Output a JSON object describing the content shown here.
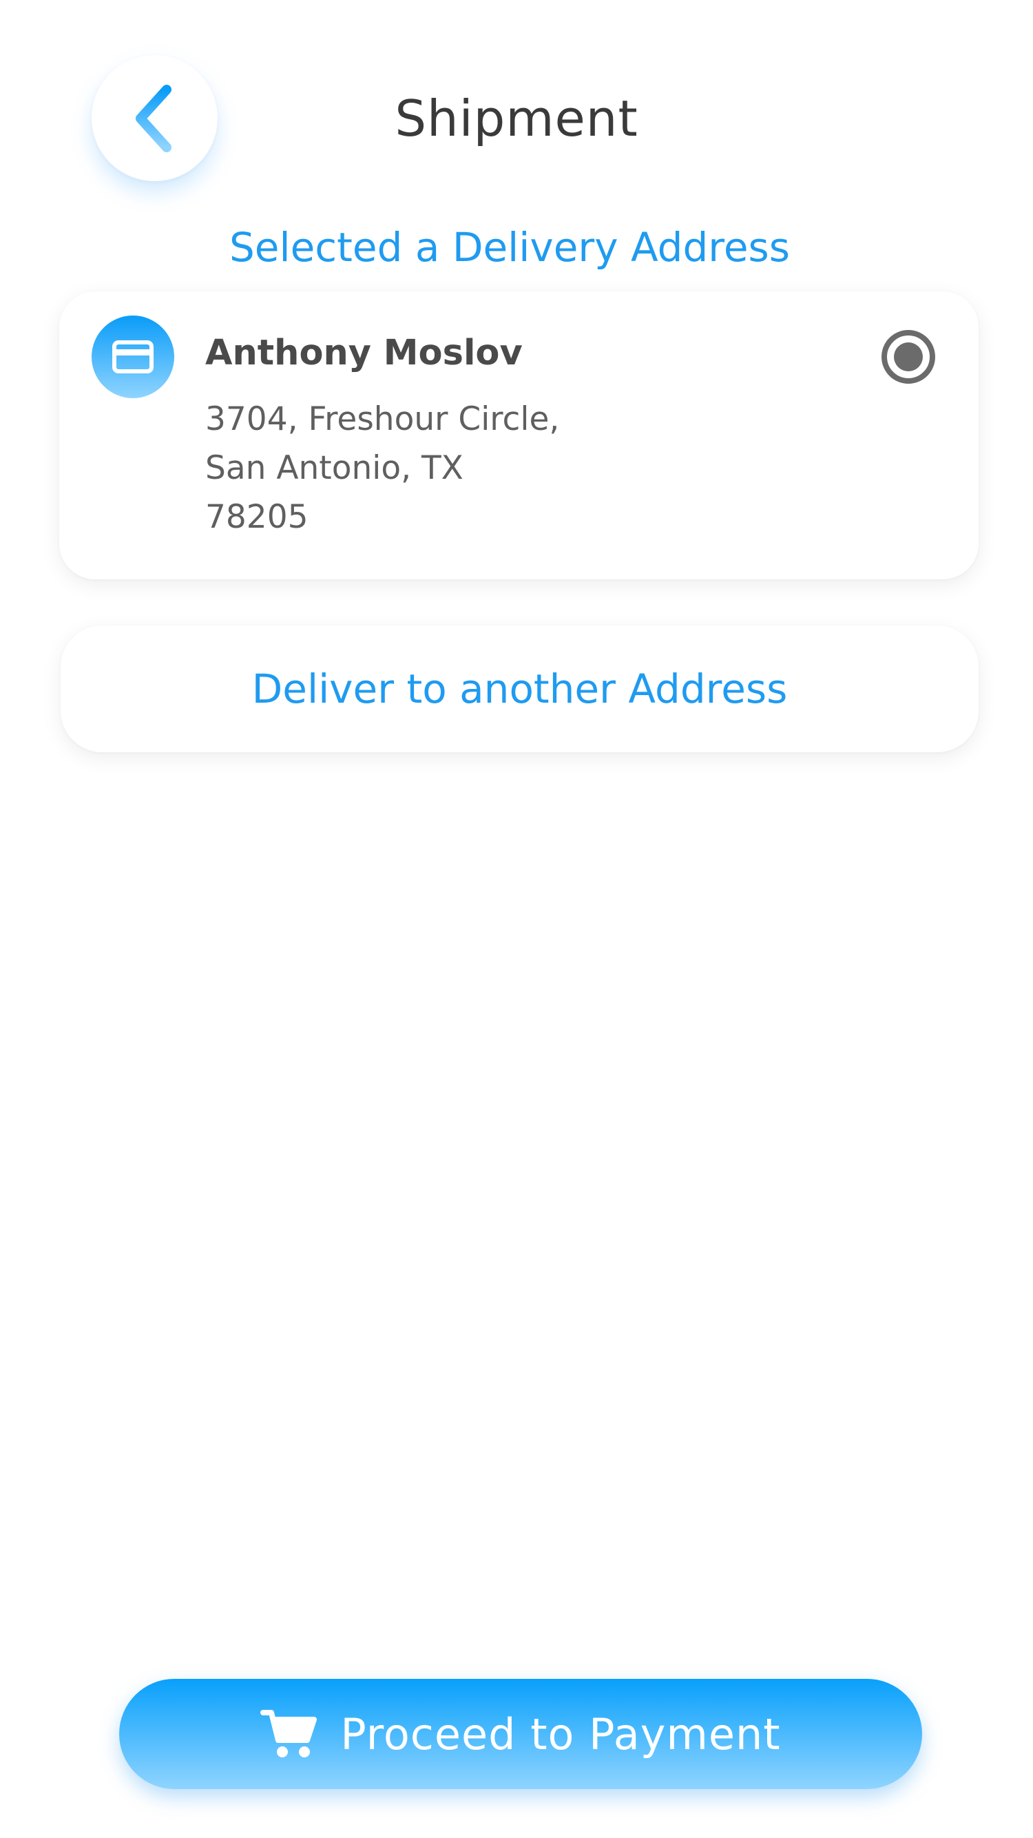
{
  "header": {
    "back_icon": "chevron-left-icon",
    "title": "Shipment"
  },
  "section_heading": "Selected a Delivery Address",
  "selected_address": {
    "icon": "card-icon",
    "name": "Anthony Moslov",
    "lines": [
      "3704, Freshour Circle,",
      "San Antonio, TX",
      "78205"
    ],
    "selected": true
  },
  "another_address_label": "Deliver to another Address",
  "proceed_button": {
    "icon": "cart-icon",
    "label": "Proceed to Payment"
  },
  "colors": {
    "accent": "#1f9bf0",
    "gradient_top": "#09a0fb",
    "gradient_bottom": "#8fd4ff",
    "text_dark": "#3a3a3a",
    "radio": "#6b6b6b"
  }
}
